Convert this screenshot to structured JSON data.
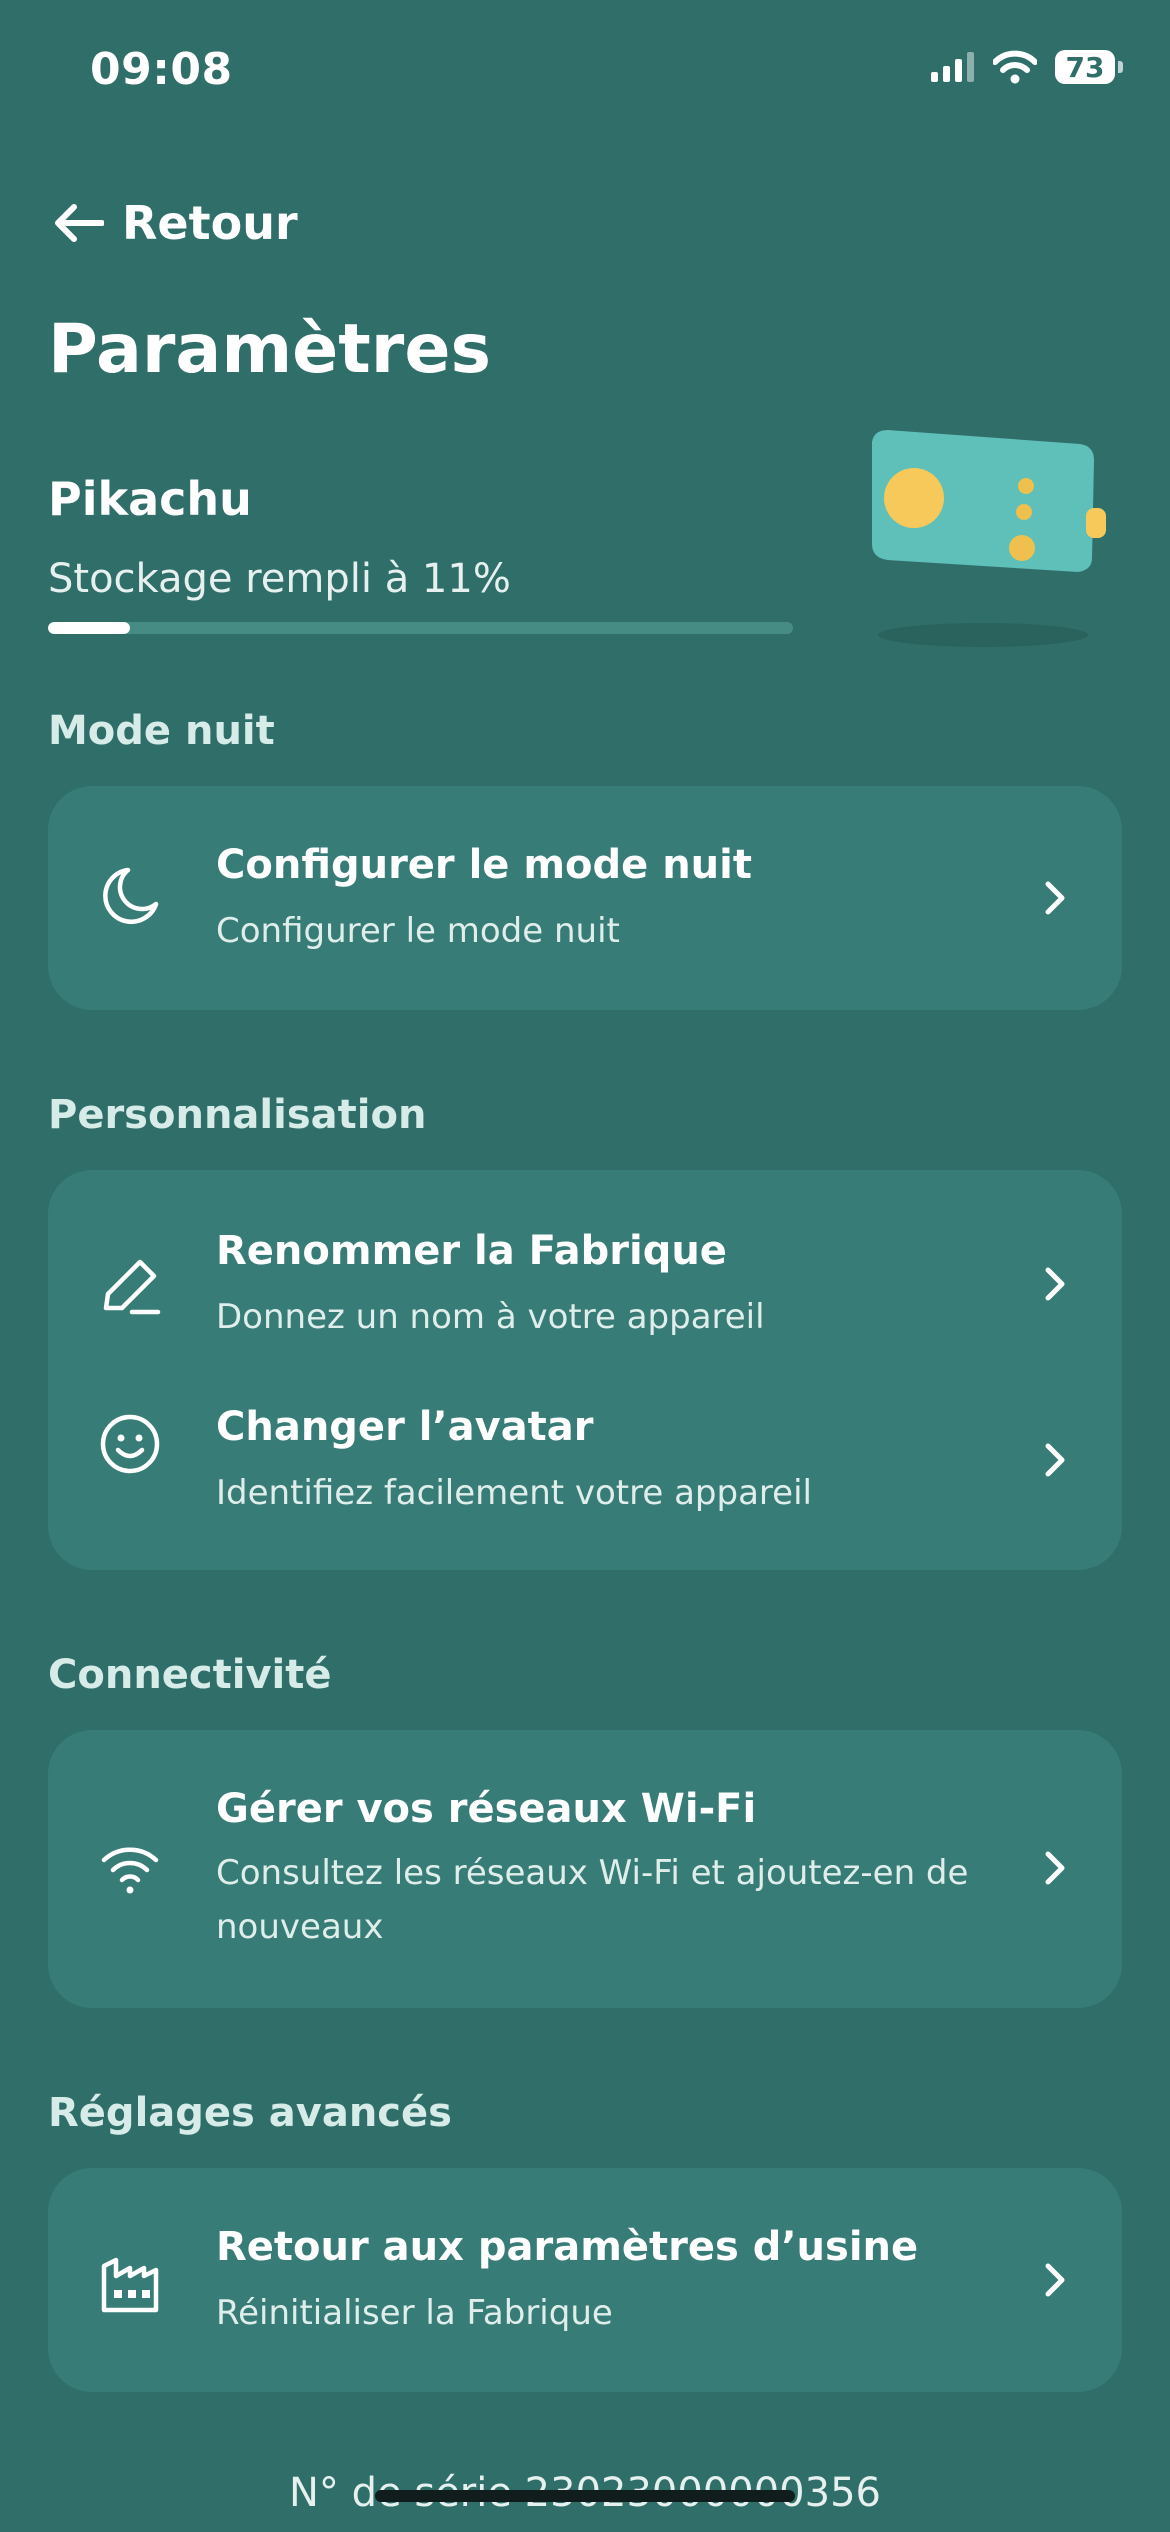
{
  "status_bar": {
    "time": "09:08",
    "battery": "73"
  },
  "nav": {
    "back_label": "Retour"
  },
  "page": {
    "title": "Paramètres"
  },
  "device": {
    "name": "Pikachu",
    "storage_text": "Stockage rempli à 11%",
    "storage_fraction": 0.11
  },
  "sections": {
    "night": {
      "title": "Mode nuit",
      "item": {
        "title": "Configurer le mode nuit",
        "subtitle": "Configurer le mode nuit",
        "icon": "moon-icon"
      }
    },
    "personalisation": {
      "title": "Personnalisation",
      "rename": {
        "title": "Renommer la Fabrique",
        "subtitle": "Donnez un nom à votre appareil",
        "icon": "pencil-icon"
      },
      "avatar": {
        "title": "Changer l’avatar",
        "subtitle": "Identifiez facilement votre appareil",
        "icon": "smiley-icon"
      }
    },
    "connectivity": {
      "title": "Connectivité",
      "wifi": {
        "title": "Gérer vos réseaux Wi-Fi",
        "subtitle": "Consultez les réseaux Wi-Fi et ajoutez-en de nouveaux",
        "icon": "wifi-icon"
      }
    },
    "advanced": {
      "title": "Réglages avancés",
      "reset": {
        "title": "Retour aux paramètres d’usine",
        "subtitle": "Réinitialiser la Fabrique",
        "icon": "factory-icon"
      }
    }
  },
  "footer": {
    "serial": "N° de série 23023000000356"
  },
  "colors": {
    "background": "#306e6a",
    "card": "#377c77",
    "accent_yellow": "#f7c95a",
    "device_teal": "#5fbfb9"
  }
}
